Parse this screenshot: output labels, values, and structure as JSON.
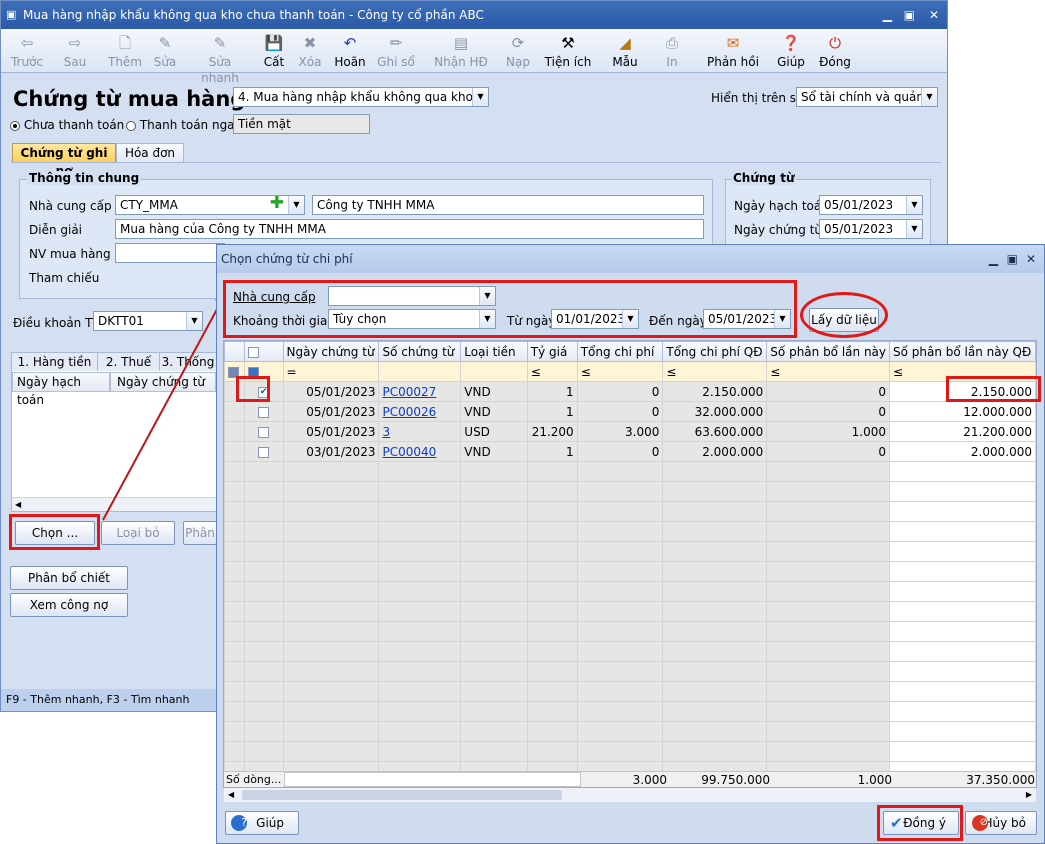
{
  "window": {
    "title": "Mua hàng nhập khẩu không qua kho chưa thanh toán - Công ty cổ phần ABC"
  },
  "toolbar": [
    "Trước",
    "Sau",
    "Thêm",
    "Sửa",
    "Sửa nhanh",
    "Cất",
    "Xóa",
    "Hoãn",
    "Ghi sổ",
    "Nhận HĐ",
    "Nạp",
    "Tiện ích",
    "Mẫu",
    "In",
    "Phản hồi",
    "Giúp",
    "Đóng"
  ],
  "form": {
    "heading": "Chứng từ mua hàng",
    "type_value": "4. Mua hàng nhập khẩu không qua kho",
    "display_label": "Hiển thị trên sổ",
    "display_value": "Sổ tài chính và quản trị",
    "radio_unpaid": "Chưa thanh toán",
    "radio_paid": "Thanh toán ngay",
    "pay_method": "Tiền mặt",
    "tab1": "Chứng từ ghi nợ",
    "tab2": "Hóa đơn",
    "general_title": "Thông tin chung",
    "supplier_label": "Nhà cung cấp",
    "supplier_code": "CTY_MMA",
    "supplier_name": "Công ty TNHH MMA",
    "desc_label": "Diễn giải",
    "desc_value": "Mua hàng của Công ty TNHH MMA",
    "buyer_label": "NV mua hàng",
    "ref_label": "Tham chiếu",
    "doc_title": "Chứng từ",
    "posting_date_label": "Ngày hạch toán",
    "posting_date": "05/01/2023",
    "doc_date_label": "Ngày chứng từ",
    "doc_date": "05/01/2023",
    "terms_label": "Điều khoản TT",
    "terms_value": "DKTT01",
    "subtabs": [
      "1. Hàng tiền",
      "2. Thuế",
      "3. Thống"
    ],
    "subcols": [
      "Ngày hạch toán",
      "Ngày chứng từ"
    ],
    "choose_btn": "Chọn ...",
    "remove_btn": "Loại bỏ",
    "alloc_btn": "Phân",
    "discount_btn": "Phân bổ chiết khấu...",
    "debt_btn": "Xem công nợ",
    "status": "F9 - Thêm nhanh, F3 - Tìm nhanh"
  },
  "dialog": {
    "title": "Chọn chứng từ chi phí",
    "supplier_label": "Nhà cung cấp",
    "period_label": "Khoảng thời gian",
    "period_value": "Tùy chọn",
    "from_label": "Từ ngày",
    "from_value": "01/01/2023",
    "to_label": "Đến ngày",
    "to_value": "05/01/2023",
    "fetch_btn": "Lấy dữ liệu",
    "columns": [
      "Ngày chứng từ",
      "Số chứng từ",
      "Loại tiền",
      "Tỷ giá",
      "Tổng chi phí",
      "Tổng chi phí QĐ",
      "Số phân bổ lần này",
      "Số phân bổ lần này QĐ"
    ],
    "filters": [
      "=",
      "",
      "",
      "≤",
      "≤",
      "≤",
      "≤",
      "≤"
    ],
    "rows": [
      {
        "checked": true,
        "date": "05/01/2023",
        "no": "PC00027",
        "cur": "VND",
        "rate": "1",
        "total": "0",
        "total_qd": "2.150.000",
        "alloc": "0",
        "alloc_qd": "2.150.000"
      },
      {
        "checked": false,
        "date": "05/01/2023",
        "no": "PC00026",
        "cur": "VND",
        "rate": "1",
        "total": "0",
        "total_qd": "32.000.000",
        "alloc": "0",
        "alloc_qd": "12.000.000"
      },
      {
        "checked": false,
        "date": "05/01/2023",
        "no": "3",
        "cur": "USD",
        "rate": "21.200",
        "total": "3.000",
        "total_qd": "63.600.000",
        "alloc": "1.000",
        "alloc_qd": "21.200.000"
      },
      {
        "checked": false,
        "date": "03/01/2023",
        "no": "PC00040",
        "cur": "VND",
        "rate": "1",
        "total": "0",
        "total_qd": "2.000.000",
        "alloc": "0",
        "alloc_qd": "2.000.000"
      }
    ],
    "footer_label": "Số dòng...",
    "footer": {
      "total": "3.000",
      "total_qd": "99.750.000",
      "alloc": "1.000",
      "alloc_qd": "37.350.000"
    },
    "help_btn": "Giúp",
    "ok_btn": "Đồng ý",
    "cancel_btn": "Hủy bỏ"
  }
}
